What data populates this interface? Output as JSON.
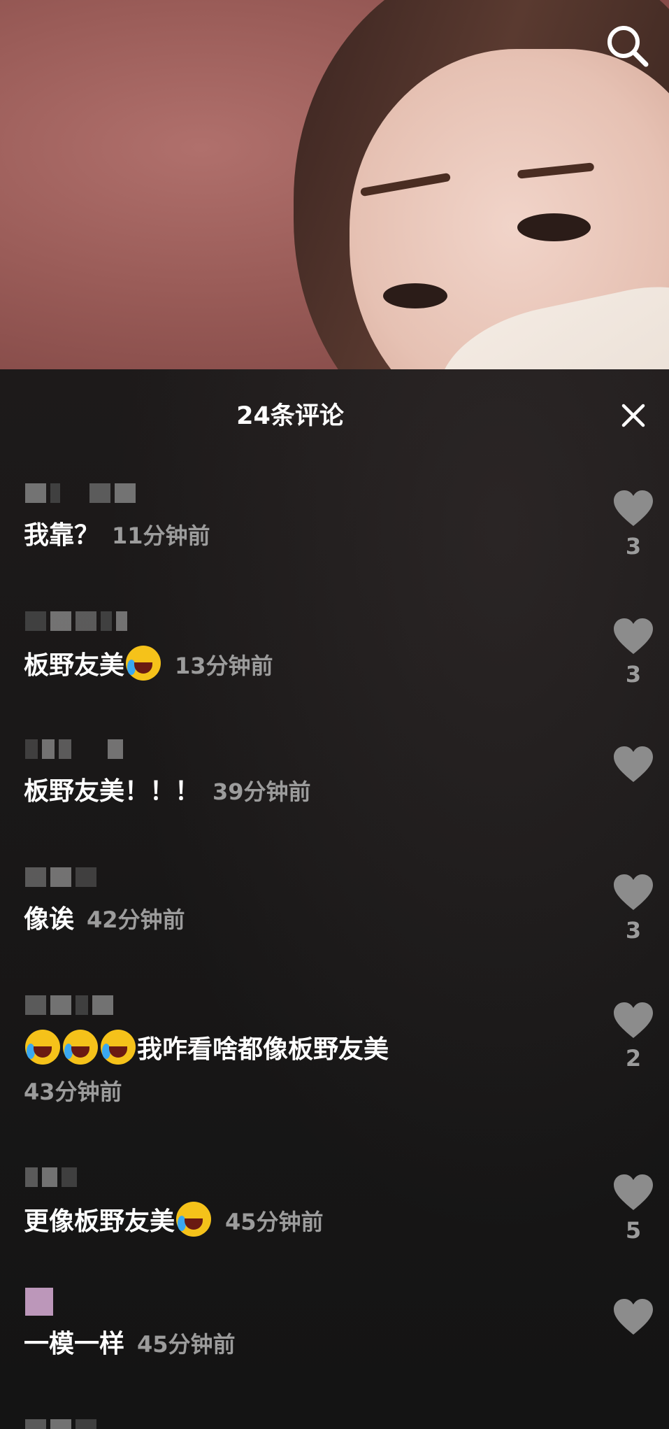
{
  "header": {
    "comment_count_title": "24条评论"
  },
  "icons": {
    "search": "search-icon",
    "close": "close-icon",
    "like": "heart-icon",
    "emoji": "rolling-on-floor-laughing-emoji"
  },
  "comments": [
    {
      "text": "我靠？",
      "time": "11分钟前",
      "likes": "3"
    },
    {
      "text": "板野友美",
      "time": "13分钟前",
      "likes": "3"
    },
    {
      "text": "板野友美！！！",
      "time": "39分钟前",
      "likes": ""
    },
    {
      "text": "像诶",
      "time": "42分钟前",
      "likes": "3"
    },
    {
      "text": "我咋看啥都像板野友美",
      "time": "43分钟前",
      "likes": "2"
    },
    {
      "text": "更像板野友美",
      "time": "45分钟前",
      "likes": "5"
    },
    {
      "text": "一模一样",
      "time": "45分钟前",
      "likes": ""
    }
  ],
  "colors": {
    "panel_bg": "#161616",
    "text_primary": "#ffffff",
    "text_secondary": "#9c9c9c",
    "heart": "#8c8c8c"
  }
}
